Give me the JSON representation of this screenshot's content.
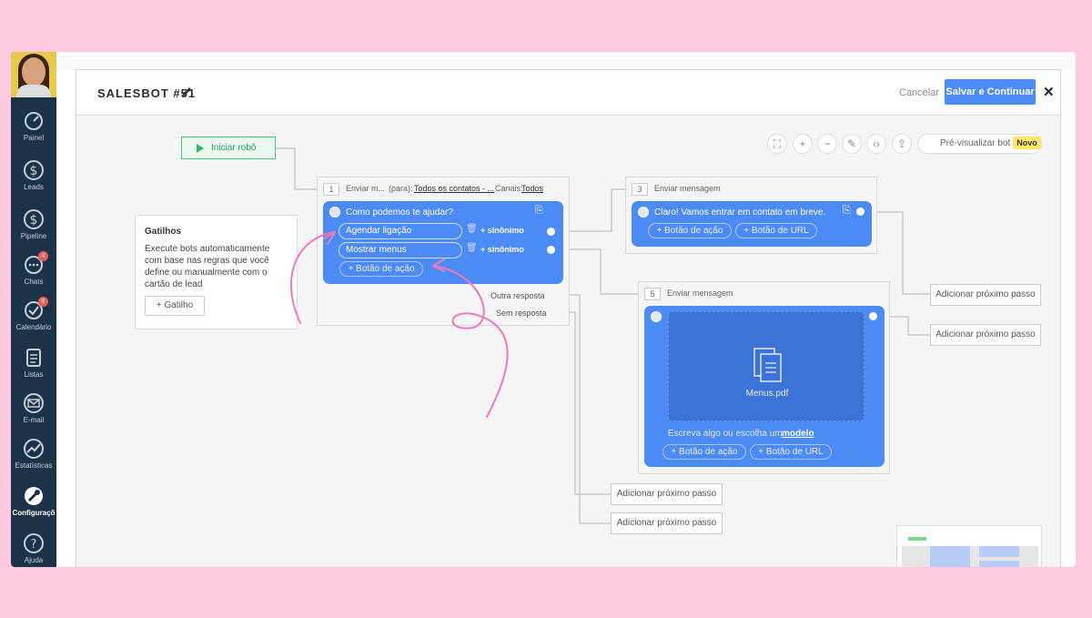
{
  "sidebar": {
    "items": [
      {
        "label": "Painel",
        "icon": "dashboard-icon"
      },
      {
        "label": "Leads",
        "icon": "dollar-icon"
      },
      {
        "label": "Pipeline",
        "icon": "dollar-icon"
      },
      {
        "label": "Chats",
        "icon": "chat-icon",
        "badge": "4"
      },
      {
        "label": "Calendário",
        "icon": "check-icon",
        "badge": "6"
      },
      {
        "label": "Listas",
        "icon": "list-icon"
      },
      {
        "label": "E-mail",
        "icon": "mail-icon"
      },
      {
        "label": "Estatísticas",
        "icon": "stats-icon"
      },
      {
        "label": "Configuraçõ",
        "icon": "settings-icon"
      },
      {
        "label": "Ajuda",
        "icon": "help-icon"
      }
    ]
  },
  "header": {
    "title": "SALESBOT #51",
    "cancel": "Cancelar",
    "save": "Salvar e Continuar",
    "close": "✕"
  },
  "toolbar": {
    "preview": "Pré-visualizar bot",
    "badge": "Novo"
  },
  "start": "Iniciar robô",
  "triggers": {
    "title": "Gatilhos",
    "text": "Execute bots automaticamente com base nas regras que você define ou manualmente com o cartão de lead",
    "button": "+ Gatilho"
  },
  "step1": {
    "num": "1",
    "action": "Enviar m...",
    "para": "(para):",
    "contacts": "Todos os contatos - ...",
    "canais_label": "Canais:",
    "canais": "Todos",
    "message": "Como podemos te ajudar?",
    "buttons": [
      "Agendar ligação",
      "Mostrar menus"
    ],
    "synonym": "+ sinônimo",
    "add_action": "+ Botão de ação",
    "other": "Outra resposta",
    "none": "Sem resposta"
  },
  "step3": {
    "num": "3",
    "action": "Enviar mensagem",
    "message": "Claro! Vamos entrar em contato em breve.",
    "add_action": "+ Botão de ação",
    "add_url": "+ Botão de URL"
  },
  "step5": {
    "num": "5",
    "action": "Enviar mensagem",
    "file": "Menus.pdf",
    "hint": "Escreva algo ou escolha um",
    "hint_link": "modelo",
    "add_action": "+ Botão de ação",
    "add_url": "+ Botão de URL"
  },
  "next_step": "Adicionar próximo passo",
  "colors": {
    "accent": "#4c8bf5",
    "background": "#fdc8e0",
    "sidebar": "#1c3247",
    "annotation": "#f07ab8"
  }
}
